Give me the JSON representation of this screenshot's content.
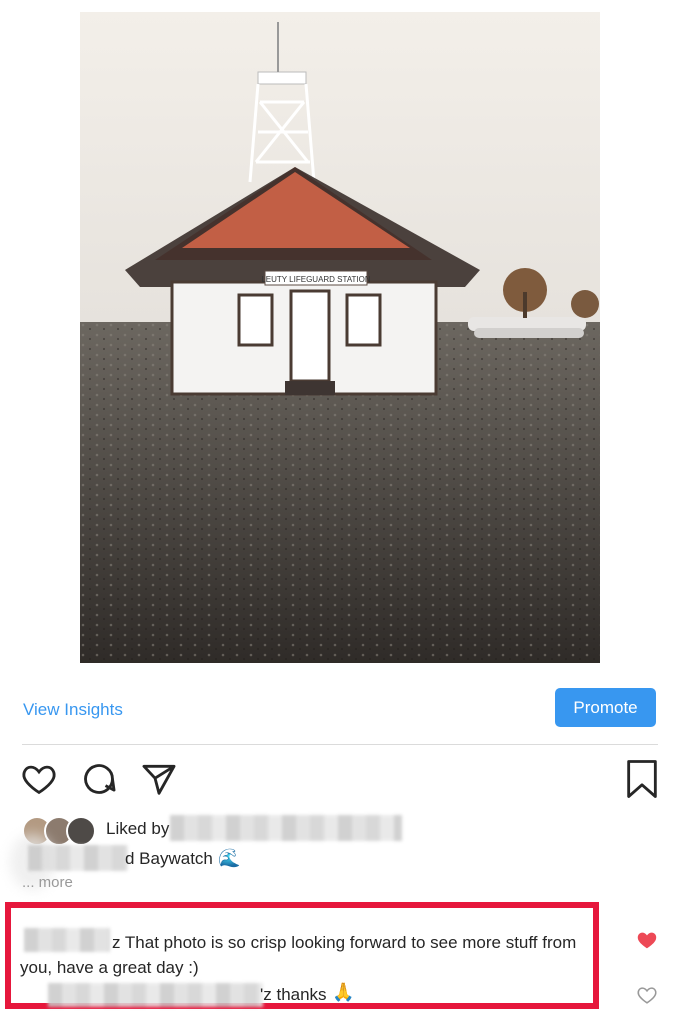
{
  "post": {
    "view_insights": "View Insights",
    "promote": "Promote",
    "liked_by_label": "Liked by",
    "caption_tail": "d Baywatch",
    "caption_emoji": "🌊",
    "more": "... more",
    "photo_sign": "LEUTY LIFEGUARD STATION"
  },
  "icons": {
    "like": "heart-outline-icon",
    "comment": "comment-bubble-icon",
    "share": "paper-plane-icon",
    "save": "bookmark-icon",
    "comment_like_filled": "heart-filled-icon",
    "comment_like_empty": "heart-outline-icon"
  },
  "comments": [
    {
      "text": "z That photo is so crisp looking forward to see more stuff from you, have a great day :)",
      "liked": true
    },
    {
      "text": "'z thanks",
      "emoji": "🙏",
      "liked": false
    }
  ],
  "colors": {
    "accent": "#3897f0",
    "highlight": "#e6173c",
    "like_red": "#ed4956"
  }
}
